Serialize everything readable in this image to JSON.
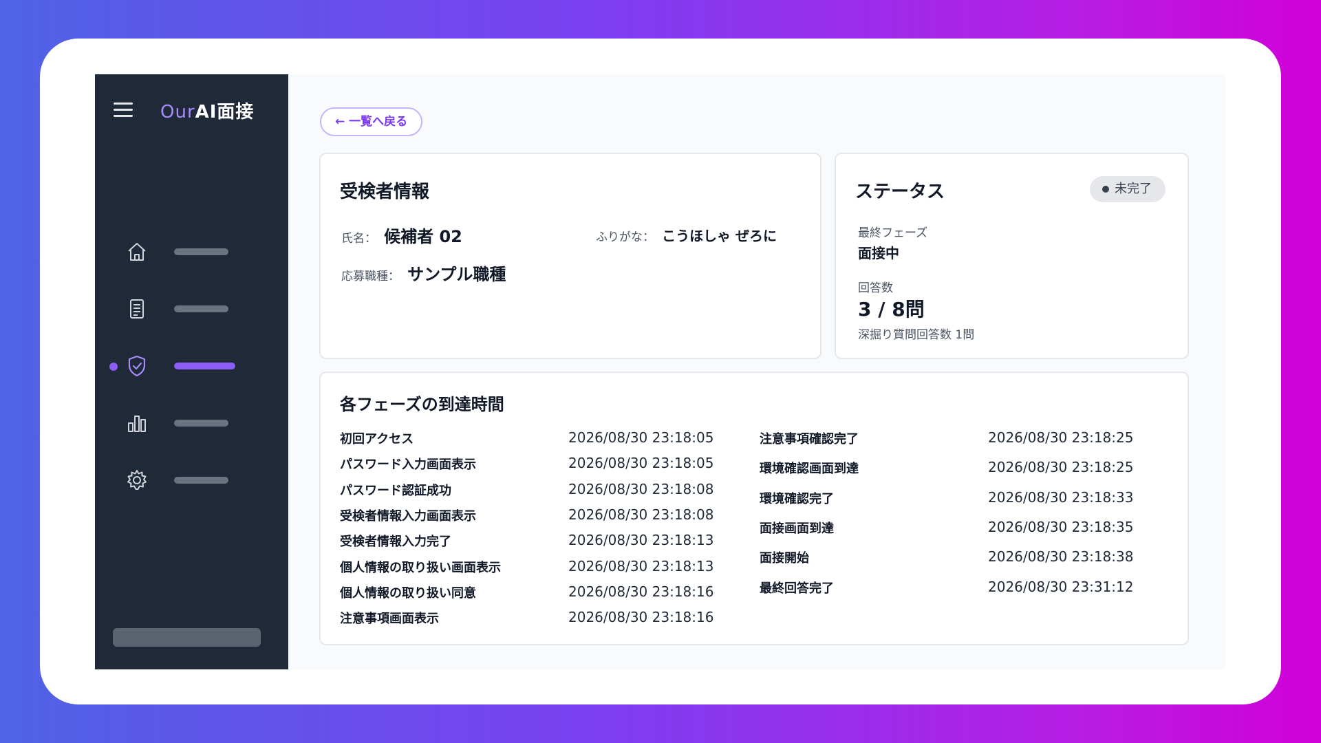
{
  "app": {
    "logo_prefix": "Our",
    "logo_main": "AI面接"
  },
  "sidebar": {
    "items": [
      {
        "icon": "home-icon",
        "active": false
      },
      {
        "icon": "document-icon",
        "active": false
      },
      {
        "icon": "shield-check-icon",
        "active": true
      },
      {
        "icon": "bar-chart-icon",
        "active": false
      },
      {
        "icon": "gear-icon",
        "active": false
      }
    ],
    "accent_color": "#8b5cf6"
  },
  "back_button": {
    "label": "← 一覧へ戻る"
  },
  "candidate": {
    "title": "受検者情報",
    "name_label": "氏名：",
    "name_value": "候補者 02",
    "furigana_label": "ふりがな：",
    "furigana_value": "こうほしゃ ぜろに",
    "job_label": "応募職種：",
    "job_value": "サンプル職種"
  },
  "status": {
    "title": "ステータス",
    "badge": "未完了",
    "final_phase_label": "最終フェーズ",
    "final_phase_value": "面接中",
    "answers_label": "回答数",
    "answers_value": "3 / 8問",
    "deep_dive_text": "深掘り質問回答数 1問"
  },
  "phases": {
    "title": "各フェーズの到達時間",
    "left": [
      {
        "name": "初回アクセス",
        "time": "2026/08/30 23:18:05"
      },
      {
        "name": "パスワード入力画面表示",
        "time": "2026/08/30 23:18:05"
      },
      {
        "name": "パスワード認証成功",
        "time": "2026/08/30 23:18:08"
      },
      {
        "name": "受検者情報入力画面表示",
        "time": "2026/08/30 23:18:08"
      },
      {
        "name": "受検者情報入力完了",
        "time": "2026/08/30 23:18:13"
      },
      {
        "name": "個人情報の取り扱い画面表示",
        "time": "2026/08/30 23:18:13"
      },
      {
        "name": "個人情報の取り扱い同意",
        "time": "2026/08/30 23:18:16"
      },
      {
        "name": "注意事項画面表示",
        "time": "2026/08/30 23:18:16"
      }
    ],
    "right": [
      {
        "name": "注意事項確認完了",
        "time": "2026/08/30 23:18:25"
      },
      {
        "name": "環境確認画面到達",
        "time": "2026/08/30 23:18:25"
      },
      {
        "name": "環境確認完了",
        "time": "2026/08/30 23:18:33"
      },
      {
        "name": "面接画面到達",
        "time": "2026/08/30 23:18:35"
      },
      {
        "name": "面接開始",
        "time": "2026/08/30 23:18:38"
      },
      {
        "name": "最終回答完了",
        "time": "2026/08/30 23:31:12"
      }
    ]
  }
}
